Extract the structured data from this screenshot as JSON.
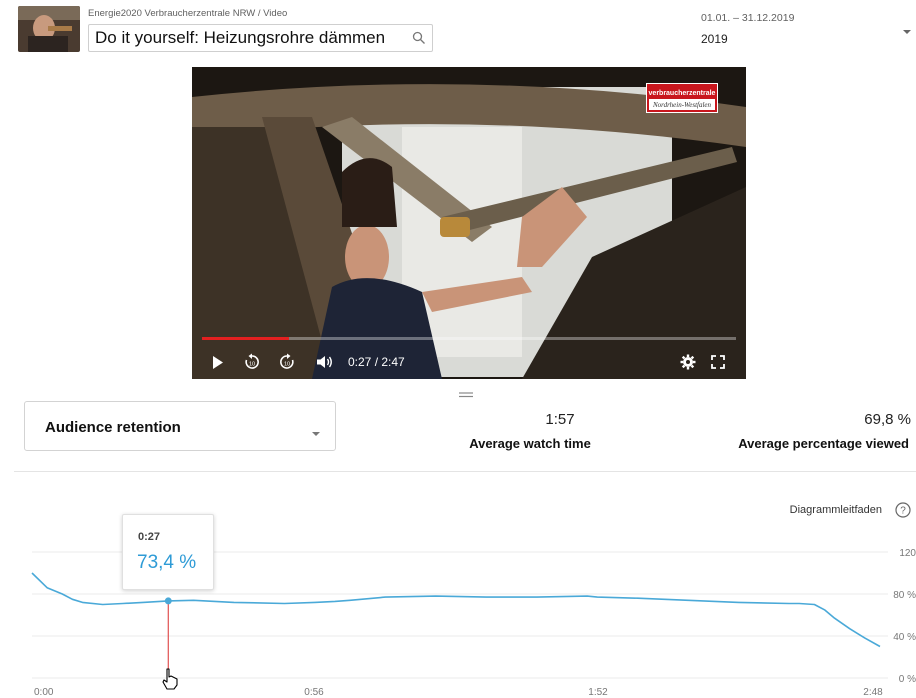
{
  "header": {
    "breadcrumb": "Energie2020 Verbraucherzentrale NRW  /  Video",
    "video_title": "Do it yourself: Heizungsrohre dämmen",
    "date_range": "01.01. – 31.12.2019",
    "year": "2019"
  },
  "player": {
    "time_readout": "0:27 / 2:47",
    "progress": 0.162,
    "logo_line1": "verbraucherzentrale",
    "logo_line2": "Nordrhein-Westfalen",
    "icons": [
      "play-icon",
      "rewind-10-icon",
      "forward-10-icon",
      "volume-icon",
      "settings-icon",
      "fullscreen-icon"
    ]
  },
  "metrics": {
    "selected_metric": "Audience retention",
    "avg_watch_time_value": "1:57",
    "avg_watch_time_label": "Average watch time",
    "avg_pct_viewed_value": "69,8 %",
    "avg_pct_viewed_label": "Average percentage viewed"
  },
  "chart_guide": "Diagrammleitfaden",
  "tooltip": {
    "time": "0:27",
    "value": "73,4 %"
  },
  "chart_data": {
    "type": "line",
    "title": "",
    "xlabel": "",
    "ylabel": "",
    "x_tick_labels": [
      "0:00",
      "0:56",
      "1:52",
      "2:48"
    ],
    "y_tick_labels": [
      "120",
      "80 %",
      "40 %",
      "0 %"
    ],
    "y_ticks": [
      120,
      80,
      40,
      0
    ],
    "ylim": [
      0,
      120
    ],
    "xlim": [
      0,
      168
    ],
    "grid": true,
    "color": "#4aa9d8",
    "marker_color": "#e05050",
    "series": [
      {
        "x": [
          0,
          3,
          6,
          8,
          10,
          14,
          18,
          22,
          27,
          32,
          40,
          50,
          56,
          60,
          63,
          70,
          80,
          90,
          100,
          110,
          112,
          120,
          130,
          140,
          150,
          152,
          155,
          157,
          159,
          162,
          165,
          168
        ],
        "y": [
          100,
          86,
          80,
          75,
          72,
          70,
          71,
          72,
          73.4,
          74,
          72,
          71,
          72,
          73,
          74,
          77,
          78,
          77,
          77,
          78,
          77,
          76,
          74,
          72,
          71,
          71,
          70,
          65,
          57,
          47,
          38,
          30
        ]
      }
    ],
    "highlight": {
      "x": 27,
      "y": 73.4
    }
  }
}
